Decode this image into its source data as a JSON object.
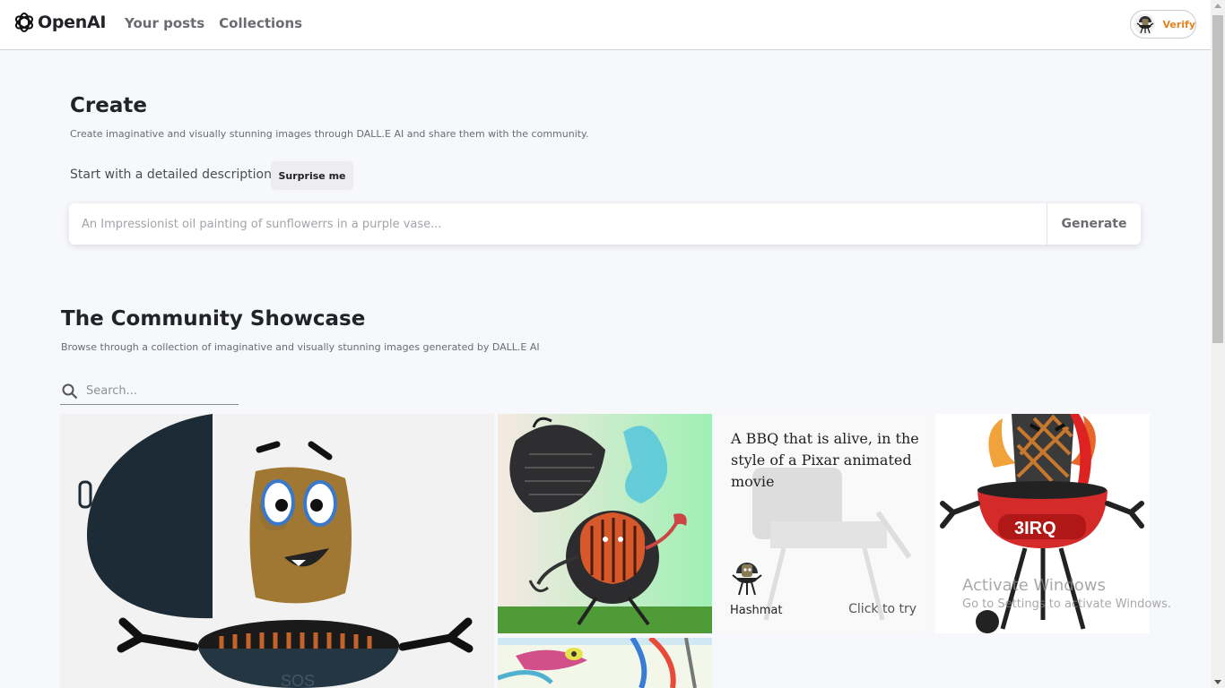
{
  "header": {
    "brand": "OpenAI",
    "nav": [
      {
        "label": "Your posts"
      },
      {
        "label": "Collections"
      }
    ],
    "verify_label": "Verify"
  },
  "create": {
    "title": "Create",
    "subtitle": "Create imaginative and visually stunning images through DALL.E AI and share them with the community.",
    "start_label": "Start with a detailed description",
    "surprise_label": "Surprise me",
    "prompt_placeholder": "An Impressionist oil painting of sunflowerrs in a purple vase...",
    "generate_label": "Generate"
  },
  "showcase": {
    "title": "The Community Showcase",
    "subtitle": "Browse through a collection of imaginative and visually stunning images generated by DALL.E AI",
    "search_placeholder": "Search...",
    "hovered_card": {
      "prompt": "A BBQ that is alive, in the style of a Pixar animated movie",
      "author": "Hashmat",
      "cta": "Click to try"
    },
    "grill_badge_text": "3IRQ",
    "grill_base_text": "SOS"
  },
  "watermark": {
    "title": "Activate Windows",
    "subtitle": "Go to Settings to activate Windows."
  },
  "colors": {
    "accent_orange": "#e4821f",
    "background": "#f7f8fb",
    "text_dark": "#222328"
  },
  "icons": [
    "openai-logo-icon",
    "avatar-icon",
    "search-icon"
  ]
}
